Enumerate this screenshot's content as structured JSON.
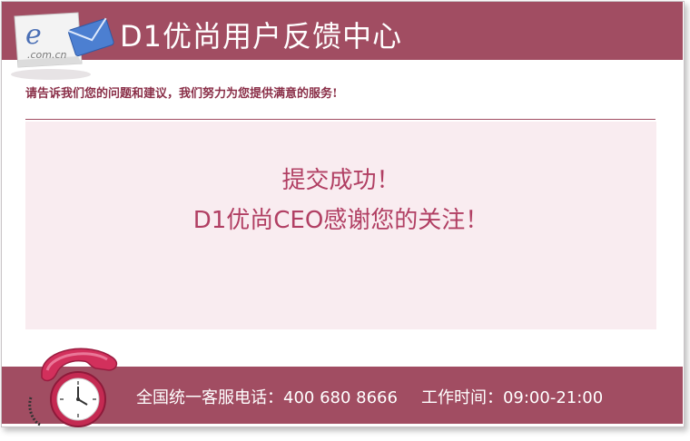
{
  "header": {
    "title": "D1优尚用户反馈中心",
    "logo_text": ".com.cn",
    "logo_letter": "e"
  },
  "intro": "请告诉我们您的问题和建议，我们努力为您提供满意的服务!",
  "message": {
    "line1": "提交成功！",
    "line2": "D1优尚CEO感谢您的关注！"
  },
  "footer": {
    "hotline": "全国统一客服电话：400 680 8666",
    "hours": "工作时间：09:00-21:00"
  },
  "icons": {
    "logo": "email-envelope-icon",
    "phone": "telephone-clock-icon"
  },
  "colors": {
    "brand": "#a14d62",
    "message_text": "#b13f63",
    "panel_bg": "#f9ecf0"
  }
}
